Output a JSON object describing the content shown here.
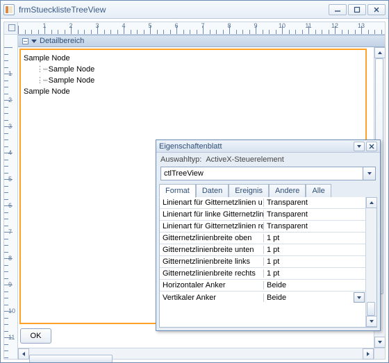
{
  "window": {
    "title": "frmStuecklisteTreeView"
  },
  "ruler": {
    "labels": [
      "1",
      "2",
      "3",
      "4",
      "5",
      "6",
      "7",
      "8",
      "9",
      "10",
      "11",
      "12",
      "13"
    ],
    "vlabels": [
      "1",
      "2",
      "3",
      "4",
      "5",
      "6",
      "7",
      "8",
      "9",
      "10",
      "11"
    ]
  },
  "section": {
    "detail": "Detailbereich"
  },
  "tree": {
    "nodes": [
      {
        "label": "Sample Node",
        "level": 0
      },
      {
        "label": "Sample Node",
        "level": 1
      },
      {
        "label": "Sample Node",
        "level": 1
      },
      {
        "label": "Sample Node",
        "level": 0
      }
    ]
  },
  "footer": {
    "ok": "OK"
  },
  "propsheet": {
    "title": "Eigenschaftenblatt",
    "subtype_label": "Auswahltyp:",
    "subtype_value": "ActiveX-Steuerelement",
    "selector": "ctlTreeView",
    "tabs": [
      "Format",
      "Daten",
      "Ereignis",
      "Andere",
      "Alle"
    ],
    "active_tab": 0,
    "rows": [
      {
        "prop": "Linienart für Gitternetzlinien u",
        "val": "Transparent"
      },
      {
        "prop": "Linienart für linke Gitternetzlin",
        "val": "Transparent"
      },
      {
        "prop": "Linienart für Gitternetzlinien re",
        "val": "Transparent"
      },
      {
        "prop": "Gitternetzlinienbreite oben",
        "val": "1 pt"
      },
      {
        "prop": "Gitternetzlinienbreite unten",
        "val": "1 pt"
      },
      {
        "prop": "Gitternetzlinienbreite links",
        "val": "1 pt"
      },
      {
        "prop": "Gitternetzlinienbreite rechts",
        "val": "1 pt"
      },
      {
        "prop": "Horizontaler Anker",
        "val": "Beide"
      },
      {
        "prop": "Vertikaler Anker",
        "val": "Beide",
        "dropdown": true
      }
    ]
  }
}
